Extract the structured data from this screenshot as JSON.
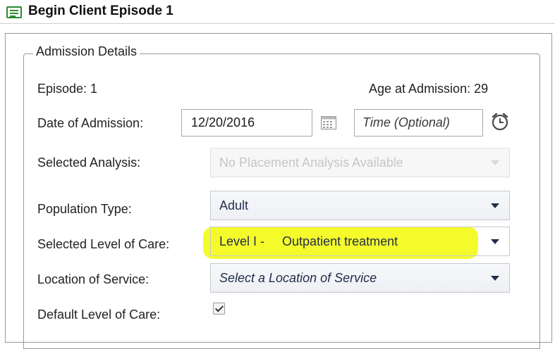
{
  "window": {
    "title": "Begin Client Episode 1"
  },
  "admission_details": {
    "legend": "Admission Details",
    "episode_label": "Episode: 1",
    "age_label": "Age at Admission: 29",
    "date_label": "Date of Admission:",
    "date_value": "12/20/2016",
    "time_placeholder": "Time (Optional)",
    "selected_analysis_label": "Selected Analysis:",
    "selected_analysis_value": "No Placement Analysis Available",
    "population_type_label": "Population Type:",
    "population_type_value": "Adult",
    "level_of_care_label": "Selected Level of Care:",
    "level_of_care_value": "Level I -     Outpatient treatment",
    "location_label": "Location of Service:",
    "location_placeholder": "Select a Location of Service",
    "default_level_label": "Default Level of Care:",
    "default_level_checked": true,
    "highlight_color": "#f4fb20"
  },
  "icons": {
    "window_icon": "list-document-icon",
    "calendar": "calendar-icon",
    "clock": "alarm-clock-icon",
    "dropdown": "chevron-down-icon",
    "check": "checkmark-icon"
  }
}
